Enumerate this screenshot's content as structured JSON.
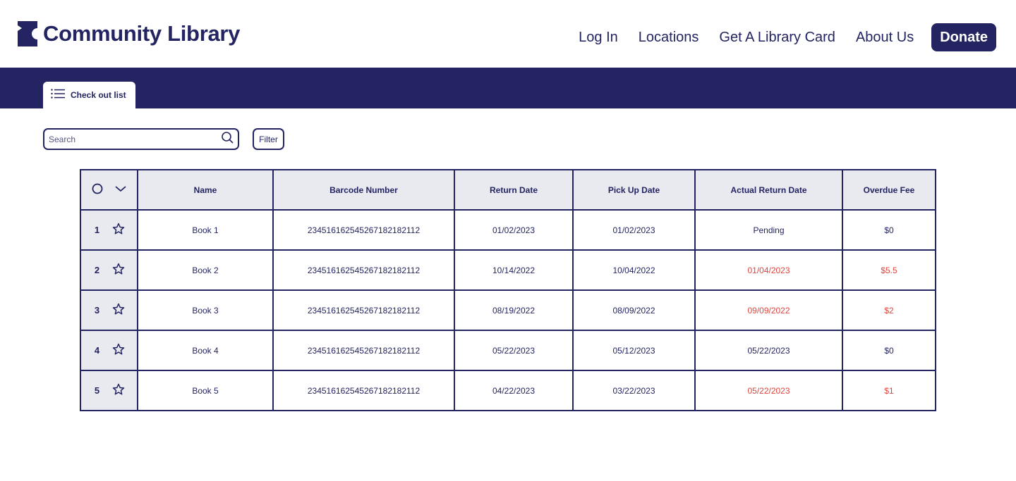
{
  "header": {
    "brand": "Community Library",
    "nav": [
      "Log In",
      "Locations",
      "Get A Library Card",
      "About Us"
    ],
    "donate_label": "Donate"
  },
  "tabs": [
    {
      "label": "Check out list",
      "icon": "list-icon"
    }
  ],
  "toolbar": {
    "search_placeholder": "Search",
    "filter_label": "Filter"
  },
  "table": {
    "columns": [
      "Name",
      "Barcode Number",
      "Return Date",
      "Pick Up Date",
      "Actual Return Date",
      "Overdue Fee"
    ],
    "rows": [
      {
        "num": "1",
        "name": "Book 1",
        "barcode": "234516162545267182182112",
        "return_date": "01/02/2023",
        "pickup_date": "01/02/2023",
        "actual_return": "Pending",
        "fee": "$0",
        "overdue": false
      },
      {
        "num": "2",
        "name": "Book 2",
        "barcode": "234516162545267182182112",
        "return_date": "10/14/2022",
        "pickup_date": "10/04/2022",
        "actual_return": "01/04/2023",
        "fee": "$5.5",
        "overdue": true
      },
      {
        "num": "3",
        "name": "Book 3",
        "barcode": "234516162545267182182112",
        "return_date": "08/19/2022",
        "pickup_date": "08/09/2022",
        "actual_return": "09/09/2022",
        "fee": "$2",
        "overdue": true
      },
      {
        "num": "4",
        "name": "Book 4",
        "barcode": "234516162545267182182112",
        "return_date": "05/22/2023",
        "pickup_date": "05/12/2023",
        "actual_return": "05/22/2023",
        "fee": "$0",
        "overdue": false
      },
      {
        "num": "5",
        "name": "Book 5",
        "barcode": "234516162545267182182112",
        "return_date": "04/22/2023",
        "pickup_date": "03/22/2023",
        "actual_return": "05/22/2023",
        "fee": "$1",
        "overdue": true
      }
    ]
  },
  "colors": {
    "brand": "#232461",
    "overdue": "#e0443e",
    "header_bg": "#e9e9f0"
  }
}
